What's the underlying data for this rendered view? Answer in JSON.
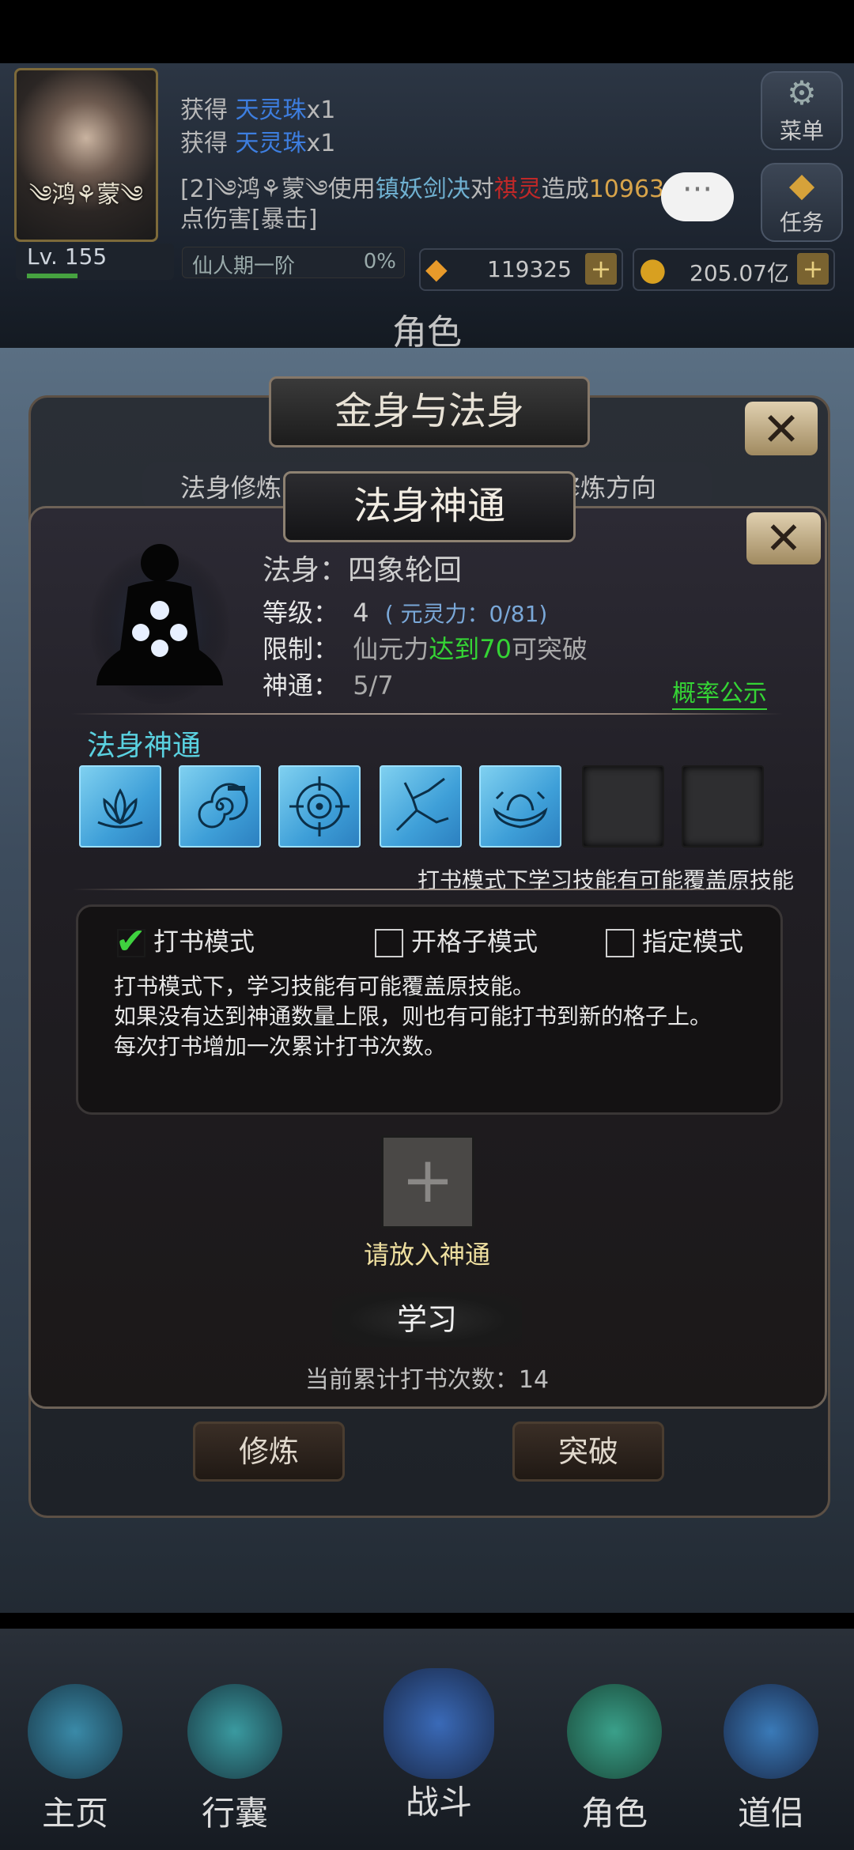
{
  "topbar": {
    "avatar_name": "༄鸿⚘蒙༄",
    "log_lines": [
      {
        "prefix": "获得 ",
        "item": "天灵珠",
        "suffix": "x1"
      },
      {
        "prefix": "获得 ",
        "item": "天灵珠",
        "suffix": "x1"
      }
    ],
    "battle_line": {
      "part1": "[2]༄鸿⚘蒙༄使用",
      "skill": "镇妖剑决",
      "part2": "对",
      "target": "祺灵",
      "part3": "造成",
      "damage": "10963430",
      "line2": "点伤害[暴击]"
    },
    "menu_label": "菜单",
    "task_label": "任务",
    "chat_bubble": "···",
    "level": "Lv. 155",
    "realm": "仙人期一阶",
    "realm_progress": "0%",
    "gems": "119325",
    "gold": "205.07亿",
    "plus": "+"
  },
  "page_title": "角色",
  "outer_panel": {
    "title": "金身与法身",
    "close": "✕",
    "tab_left": "法身修炼",
    "tab_right": "修炼方向"
  },
  "inner_panel": {
    "title": "法身神通",
    "close": "✕",
    "body_name": "法身：四象轮回",
    "level_label": "等级：",
    "level_value": "4",
    "level_extra": "( 元灵力：0/81)",
    "limit_label": "限制：",
    "limit_text_a": "仙元力",
    "limit_text_b": "达到70",
    "limit_text_c": "可突破",
    "skill_label": "神通：",
    "skill_count": "5/7",
    "prob_link": "概率公示",
    "skills_title": "法身神通",
    "skill_icons": [
      "lotus-icon",
      "spiral-icon",
      "target-icon",
      "crack-icon",
      "ingot-icon"
    ],
    "hint": "打书模式下学习技能有可能覆盖原技能",
    "modes": [
      "打书模式",
      "开格子模式",
      "指定模式"
    ],
    "desc_lines": [
      "打书模式下，学习技能有可能覆盖原技能。",
      "如果没有达到神通数量上限，则也有可能打书到新的格子上。",
      "每次打书增加一次累计打书次数。"
    ],
    "place_label": "请放入神通",
    "learn_button": "学习",
    "count_text": "当前累计打书次数：14"
  },
  "bottom_buttons": {
    "train": "修炼",
    "breakthrough": "突破"
  },
  "nav": [
    "主页",
    "行囊",
    "战斗",
    "角色",
    "道侣"
  ],
  "colors": {
    "accent_green": "#35d435",
    "skill_blue": "#3e9fd8",
    "title_cyan": "#5ad1e0"
  }
}
